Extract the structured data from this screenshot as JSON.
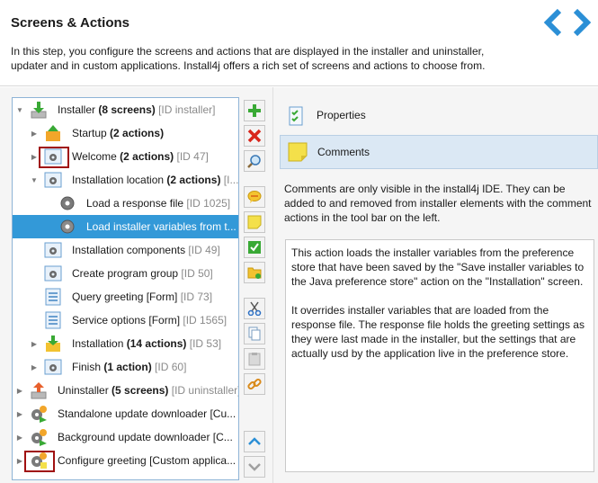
{
  "header": {
    "title": "Screens & Actions",
    "description": "In this step, you configure the screens and actions that are displayed in the installer and uninstaller, updater and in custom applications. Install4j offers a rich set of screens and actions to choose from."
  },
  "tree": {
    "rows": [
      {
        "label": "Installer",
        "bold": "(8 screens)",
        "id": "[ID installer]"
      },
      {
        "label": "Startup",
        "bold": "(2 actions)",
        "id": ""
      },
      {
        "label": "Welcome",
        "bold": "(2 actions)",
        "id": "[ID 47]"
      },
      {
        "label": "Installation location",
        "bold": "(2 actions)",
        "id": "[I..."
      },
      {
        "label": "Load a response file",
        "bold": "",
        "id": "[ID 1025]"
      },
      {
        "label": "Load installer variables from t...",
        "bold": "",
        "id": ""
      },
      {
        "label": "Installation components",
        "bold": "",
        "id": "[ID 49]"
      },
      {
        "label": "Create program group",
        "bold": "",
        "id": "[ID 50]"
      },
      {
        "label": "Query greeting [Form]",
        "bold": "",
        "id": "[ID 73]"
      },
      {
        "label": "Service options [Form]",
        "bold": "",
        "id": "[ID 1565]"
      },
      {
        "label": "Installation",
        "bold": "(14 actions)",
        "id": "[ID 53]"
      },
      {
        "label": "Finish",
        "bold": "(1 action)",
        "id": "[ID 60]"
      },
      {
        "label": "Uninstaller",
        "bold": "(5 screens)",
        "id": "[ID uninstaller]"
      },
      {
        "label": "Standalone update downloader [Cu...",
        "bold": "",
        "id": ""
      },
      {
        "label": "Background update downloader [C...",
        "bold": "",
        "id": ""
      },
      {
        "label": "Configure greeting [Custom applica...",
        "bold": "",
        "id": ""
      }
    ]
  },
  "tabs": {
    "properties": "Properties",
    "comments": "Comments"
  },
  "info": "Comments are only visible in the install4j IDE. They can be added to and removed from installer elements with the comment actions in the tool bar on the left.",
  "comment": {
    "para1": "This action loads the installer variables from the preference store that have been saved by the \"Save installer variables to the Java preference store\" action on the \"Installation\" screen.",
    "para2": "It overrides installer variables that are loaded from the response file. The response file holds the greeting settings as they were last made in the installer, but the settings that are actually usd by the application live in the preference store."
  },
  "colors": {
    "selection": "#3399d8",
    "nav_arrow": "#2b8fd6",
    "highlight_box": "#a01010"
  }
}
